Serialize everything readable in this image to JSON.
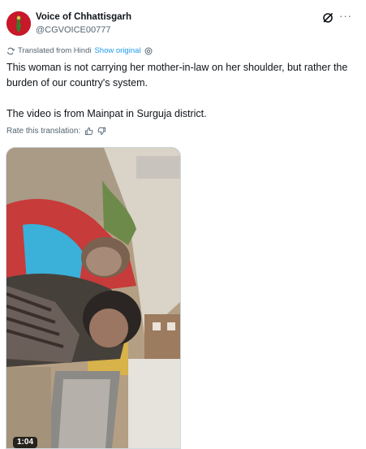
{
  "author": {
    "display_name": "Voice of Chhattisgarh",
    "handle": "@CGVOICE00777",
    "avatar_icon": "map-figure-icon",
    "avatar_color": "#c8182a"
  },
  "translation": {
    "label": "Translated from Hindi",
    "show_original": "Show original"
  },
  "post": {
    "paragraph_1": "This woman is not carrying her mother-in-law on her shoulder, but rather the burden of our country's system.",
    "paragraph_2": "The video is from Mainpat in Surguja district."
  },
  "rate": {
    "label": "Rate this translation:"
  },
  "video": {
    "duration": "1:04"
  },
  "colors": {
    "link": "#1d9bf0",
    "muted": "#536471",
    "text": "#0f1419"
  }
}
